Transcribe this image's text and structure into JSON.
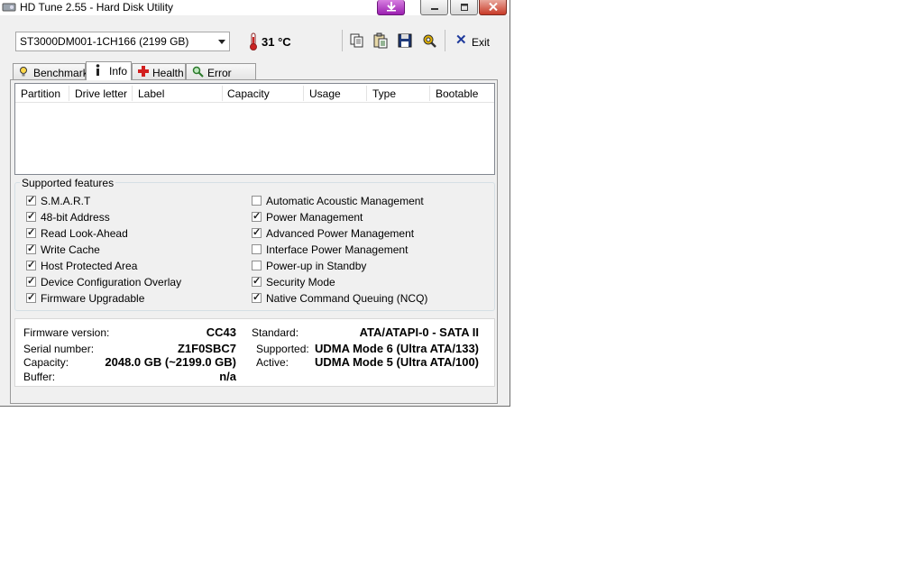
{
  "window": {
    "title": "HD Tune 2.55 - Hard Disk Utility"
  },
  "toolbar": {
    "drive": "ST3000DM001-1CH166 (2199 GB)",
    "temperature": "31 °C",
    "exit_label": "Exit"
  },
  "tabs": [
    {
      "label": "Benchmark",
      "icon": "lightbulb-icon",
      "active": false
    },
    {
      "label": "Info",
      "icon": "info-icon",
      "active": true
    },
    {
      "label": "Health",
      "icon": "health-cross-icon",
      "active": false
    },
    {
      "label": "Error Scan",
      "icon": "magnifier-icon",
      "active": false
    }
  ],
  "partition_table": {
    "columns": [
      "Partition",
      "Drive letter",
      "Label",
      "Capacity",
      "Usage",
      "Type",
      "Bootable"
    ],
    "rows": []
  },
  "features": {
    "legend": "Supported features",
    "left": [
      {
        "label": "S.M.A.R.T",
        "checked": true
      },
      {
        "label": "48-bit Address",
        "checked": true
      },
      {
        "label": "Read Look-Ahead",
        "checked": true
      },
      {
        "label": "Write Cache",
        "checked": true
      },
      {
        "label": "Host Protected Area",
        "checked": true
      },
      {
        "label": "Device Configuration Overlay",
        "checked": true
      },
      {
        "label": "Firmware Upgradable",
        "checked": true
      }
    ],
    "right": [
      {
        "label": "Automatic Acoustic Management",
        "checked": false
      },
      {
        "label": "Power Management",
        "checked": true
      },
      {
        "label": "Advanced Power Management",
        "checked": true
      },
      {
        "label": "Interface Power Management",
        "checked": false
      },
      {
        "label": "Power-up in Standby",
        "checked": false
      },
      {
        "label": "Security Mode",
        "checked": true
      },
      {
        "label": "Native Command Queuing (NCQ)",
        "checked": true
      }
    ]
  },
  "info": {
    "firmware_label": "Firmware version:",
    "firmware_value": "CC43",
    "serial_label": "Serial number:",
    "serial_value": "Z1F0SBC7",
    "capacity_label": "Capacity:",
    "capacity_value": "2048.0 GB (~2199.0 GB)",
    "buffer_label": "Buffer:",
    "buffer_value": "n/a",
    "standard_label": "Standard:",
    "standard_value": "ATA/ATAPI-0 - SATA II",
    "supported_label": "Supported:",
    "supported_value": "UDMA Mode 6 (Ultra ATA/133)",
    "active_label": "Active:",
    "active_value": "UDMA Mode 5 (Ultra ATA/100)"
  },
  "colors": {
    "accent_download": "#9b1fb0",
    "close_button": "#c83a27",
    "temp_red": "#cc2222"
  }
}
